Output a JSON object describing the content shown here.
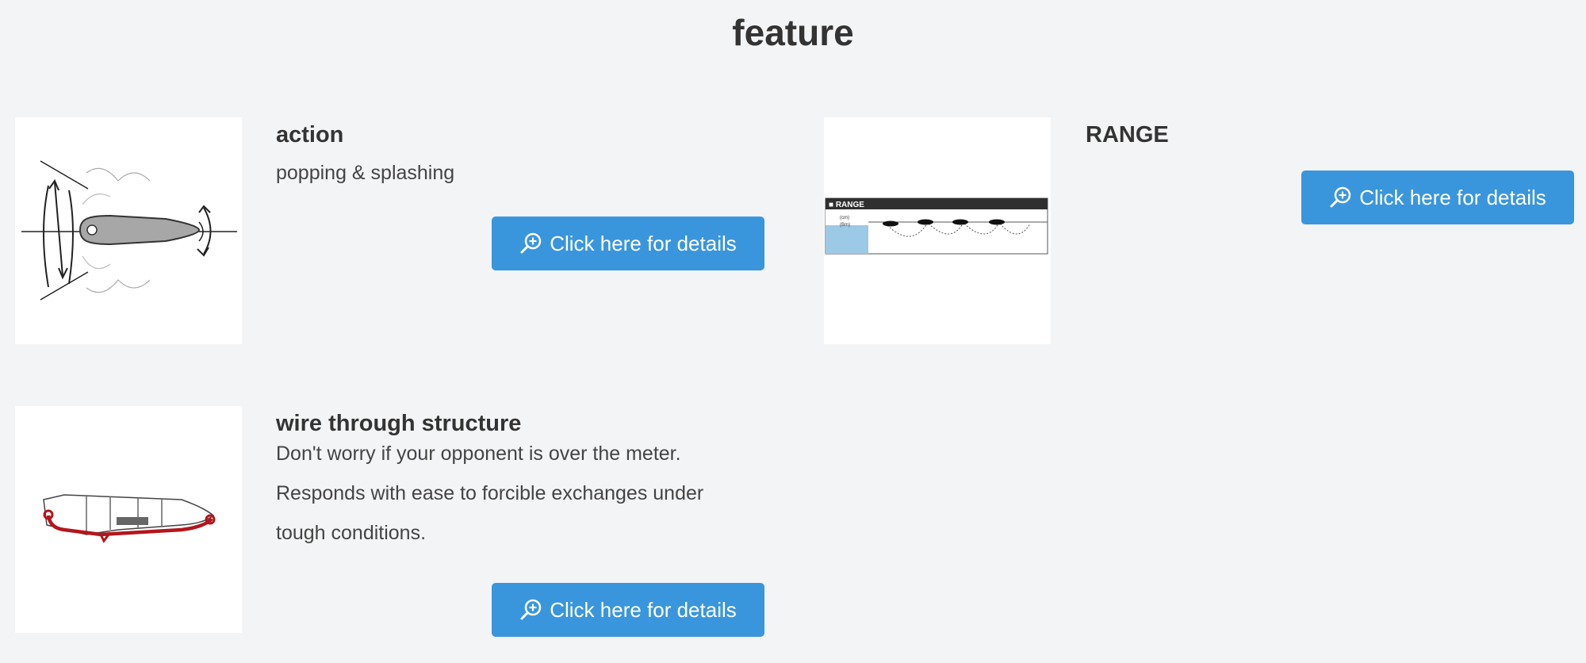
{
  "section": {
    "title": "feature"
  },
  "features": [
    {
      "title": "action",
      "description": "popping & splashing",
      "button_label": "Click here for details",
      "image_icon": "lure-action-diagram"
    },
    {
      "title": "RANGE",
      "description": "",
      "button_label": "Click here for details",
      "image_icon": "range-diagram",
      "image_text": {
        "header": "■ RANGE",
        "label_top": "(cm)",
        "label_bottom": "(Bm)"
      }
    },
    {
      "title": "wire through structure",
      "description": "Don't worry if your opponent is over the meter.\nResponds with ease to forcible exchanges under\ntough conditions.",
      "button_label": "Click here for details",
      "image_icon": "wire-through-diagram"
    }
  ],
  "colors": {
    "background": "#f3f4f6",
    "button": "#3a96dc",
    "button_text": "#ffffff",
    "title_text": "#333333",
    "wire_red": "#b3161c"
  },
  "icons": {
    "button_icon": "zoom-in-icon"
  }
}
